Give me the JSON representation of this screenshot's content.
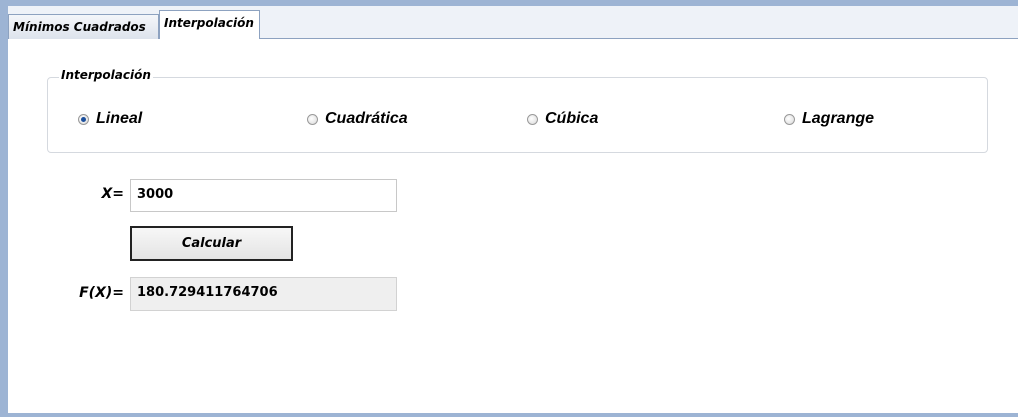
{
  "tabs": [
    {
      "label": "Mínimos Cuadrados",
      "active": false
    },
    {
      "label": "Interpolación",
      "active": true
    }
  ],
  "interpolation_group": {
    "title": "Interpolación",
    "options": [
      {
        "label": "Lineal",
        "checked": true
      },
      {
        "label": "Cuadrática",
        "checked": false
      },
      {
        "label": "Cúbica",
        "checked": false
      },
      {
        "label": "Lagrange",
        "checked": false
      }
    ]
  },
  "x_field": {
    "label": "X=",
    "value": "3000"
  },
  "calculate_button": {
    "label": "Calcular"
  },
  "fx_field": {
    "label": "F(X)=",
    "value": "180.729411764706"
  },
  "colors": {
    "frame": "#9db4d4",
    "radio_selected": "#1c4f9c"
  }
}
